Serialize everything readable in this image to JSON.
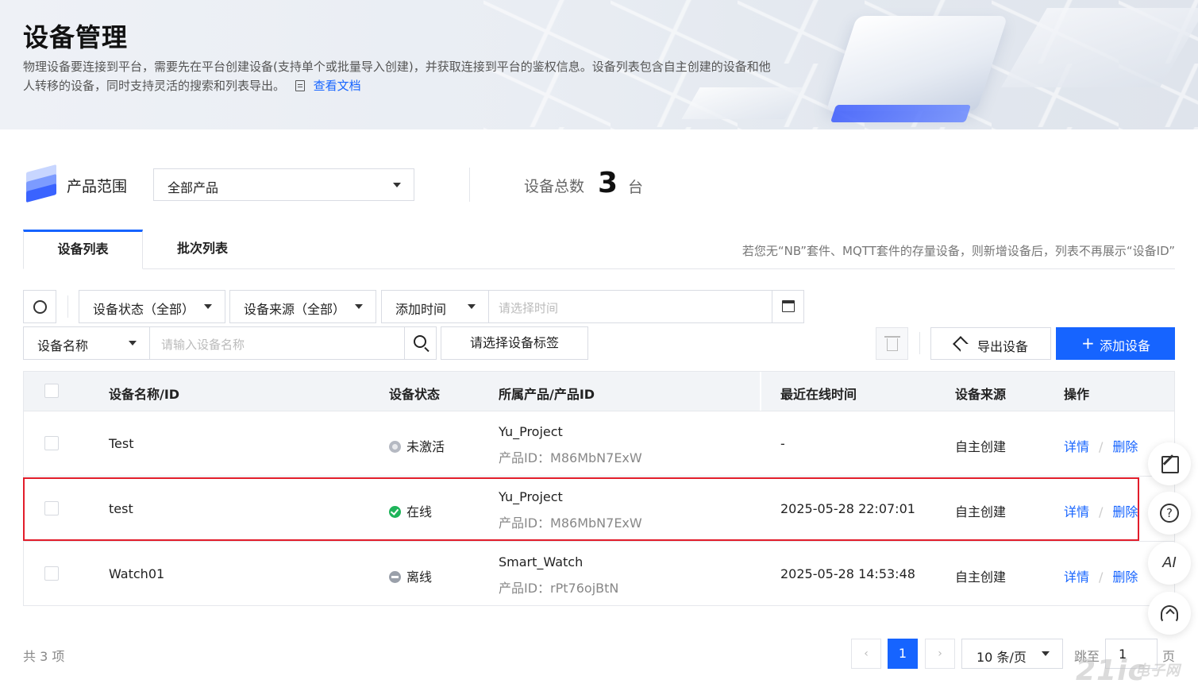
{
  "header": {
    "title": "设备管理",
    "description": "物理设备要连接到平台，需要先在平台创建设备(支持单个或批量导入创建)，并获取连接到平台的鉴权信息。设备列表包含自主创建的设备和他人转移的设备，同时支持灵活的搜索和列表导出。",
    "doc_link": "查看文档"
  },
  "product_range": {
    "label": "产品范围",
    "selected": "全部产品"
  },
  "device_total": {
    "label": "设备总数",
    "count": "3",
    "unit": "台"
  },
  "tabs": [
    {
      "label": "设备列表",
      "active": true
    },
    {
      "label": "批次列表",
      "active": false
    }
  ],
  "tab_notice": "若您无“NB”套件、MQTT套件的存量设备，则新增设备后，列表不再展示“设备ID”",
  "filters": {
    "status_select": "设备状态（全部）",
    "source_select": "设备来源（全部）",
    "time_select": "添加时间",
    "date_placeholder": "请选择时间",
    "name_select": "设备名称",
    "name_placeholder": "请输入设备名称",
    "tag_button": "请选择设备标签"
  },
  "actions": {
    "export": "导出设备",
    "add": "添加设备",
    "add_plus": "+"
  },
  "table": {
    "columns": [
      "设备名称/ID",
      "设备状态",
      "所属产品/产品ID",
      "最近在线时间",
      "设备来源",
      "操作"
    ],
    "rows": [
      {
        "name": "Test",
        "status": "未激活",
        "status_type": "inactive",
        "product": "Yu_Project",
        "product_id": "产品ID：M86MbN7ExW",
        "last_online": "-",
        "source": "自主创建",
        "op_detail": "详情",
        "op_sep": "/",
        "op_delete": "删除"
      },
      {
        "name": "test",
        "status": "在线",
        "status_type": "online",
        "product": "Yu_Project",
        "product_id": "产品ID：M86MbN7ExW",
        "last_online": "2025-05-28 22:07:01",
        "source": "自主创建",
        "op_detail": "详情",
        "op_sep": "/",
        "op_delete": "删除"
      },
      {
        "name": "Watch01",
        "status": "离线",
        "status_type": "offline",
        "product": "Smart_Watch",
        "product_id": "产品ID：rPt76ojBtN",
        "last_online": "2025-05-28 14:53:48",
        "source": "自主创建",
        "op_detail": "详情",
        "op_sep": "/",
        "op_delete": "删除"
      }
    ]
  },
  "pagination": {
    "total": "共 3 项",
    "prev": "‹",
    "current": "1",
    "next": "›",
    "page_size": "10 条/页",
    "jump_label": "跳至",
    "jump_value": "1",
    "page_unit": "页"
  },
  "float_tools": {
    "ai_label": "AI",
    "help_label": "?"
  },
  "watermark": {
    "brand": "21ic",
    "site": "电子网"
  },
  "colors": {
    "primary": "#1664ff",
    "online": "#1eb45a",
    "highlight_border": "#e21d2b"
  }
}
